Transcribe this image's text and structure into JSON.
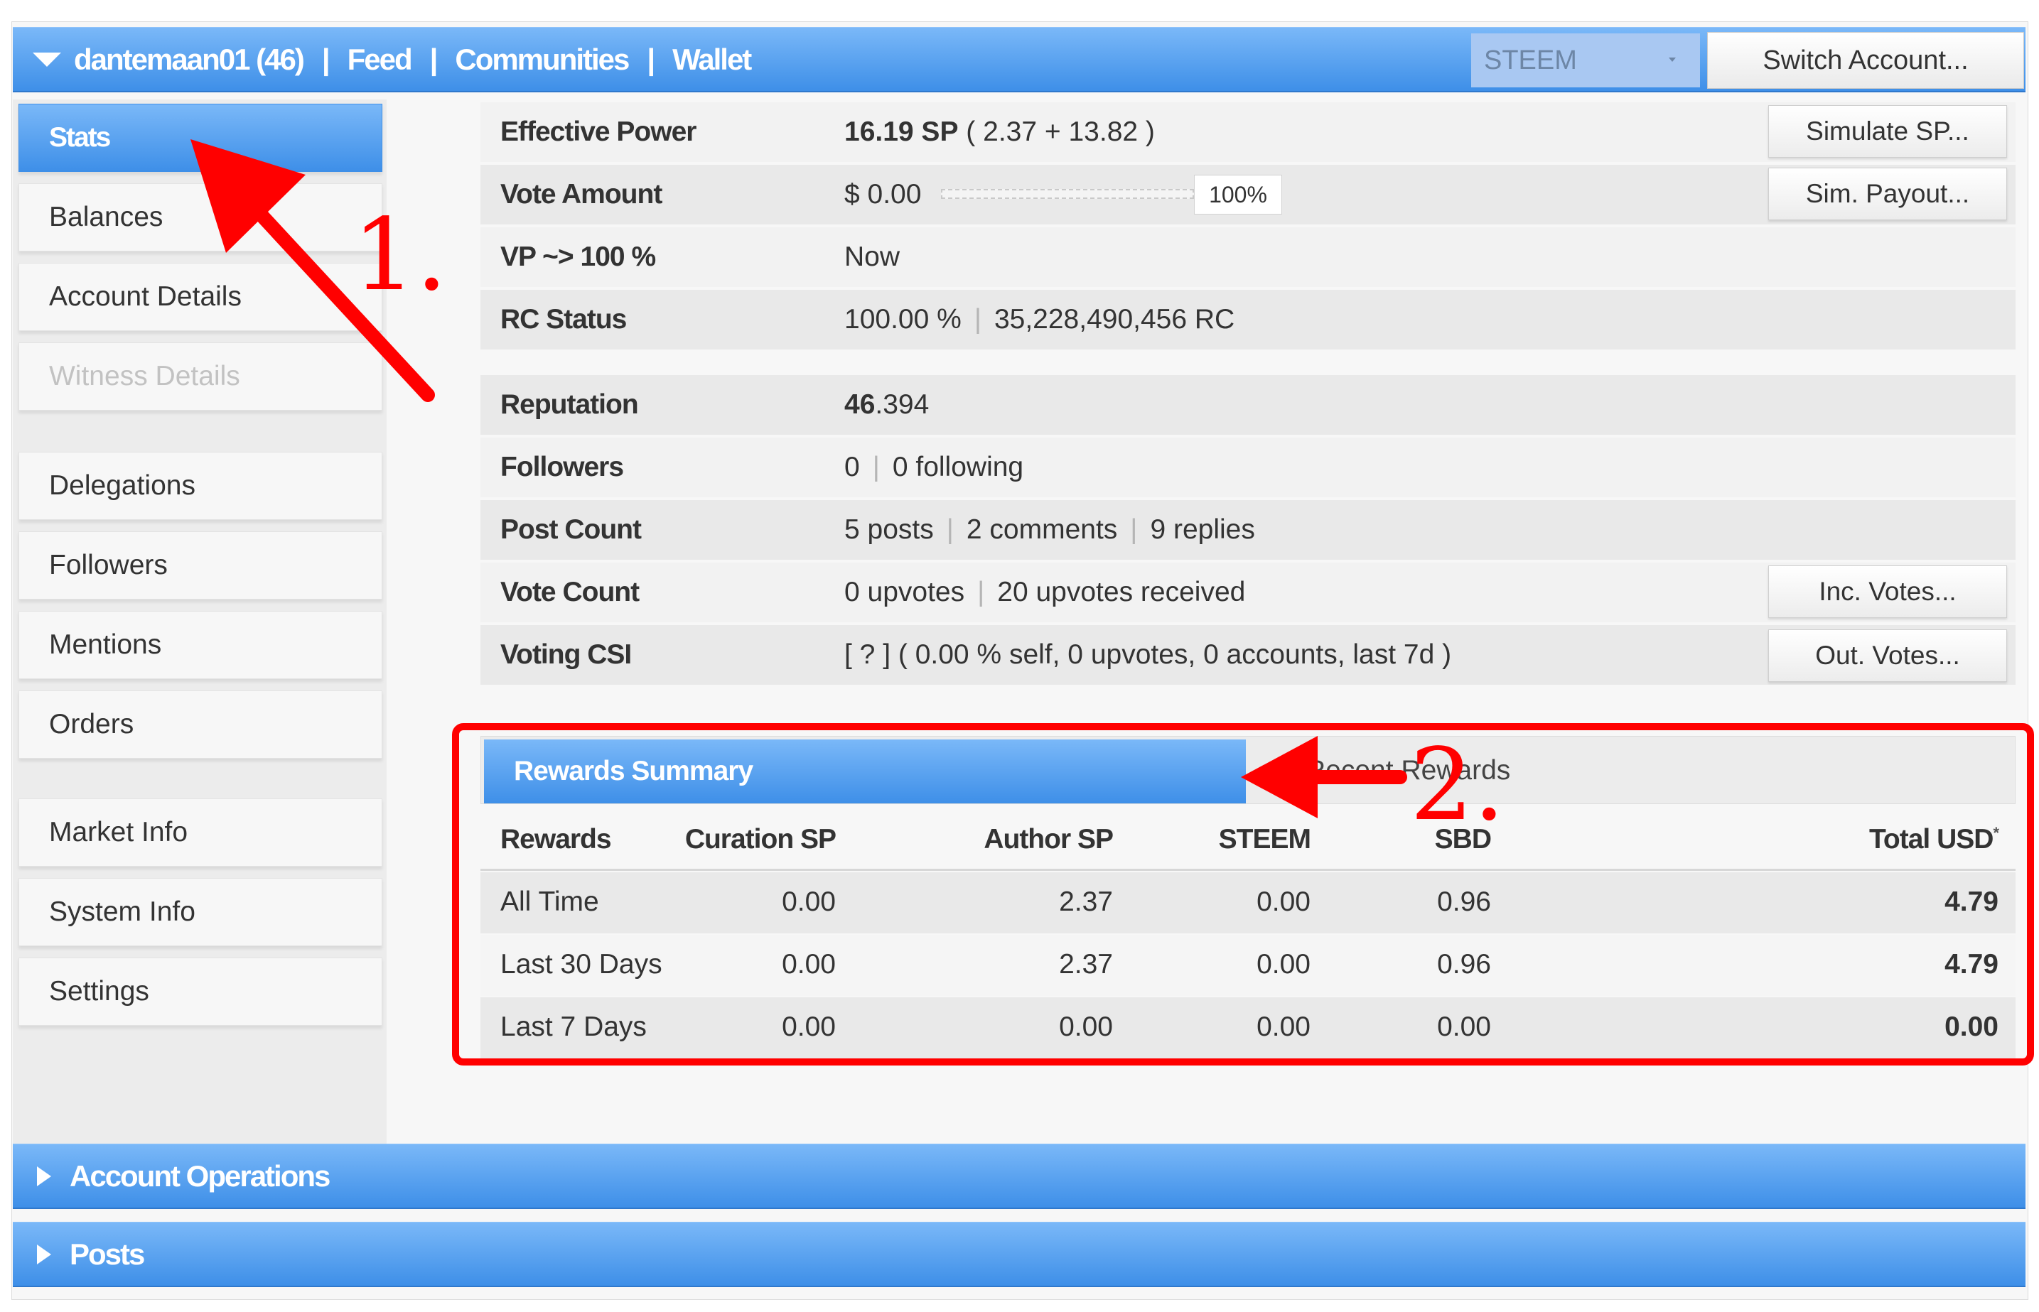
{
  "header": {
    "account": "dantemaan01 (46)",
    "nav": [
      {
        "label": "Feed"
      },
      {
        "label": "Communities"
      },
      {
        "label": "Wallet"
      }
    ],
    "separator": "|",
    "currency_select": "STEEM",
    "switch_button": "Switch Account..."
  },
  "sidebar": {
    "items": [
      {
        "label": "Stats",
        "state": "active"
      },
      {
        "label": "Balances"
      },
      {
        "label": "Account Details"
      },
      {
        "label": "Witness Details",
        "state": "disabled"
      },
      {
        "label": "Delegations"
      },
      {
        "label": "Followers"
      },
      {
        "label": "Mentions"
      },
      {
        "label": "Orders"
      },
      {
        "label": "Market Info"
      },
      {
        "label": "System Info"
      },
      {
        "label": "Settings"
      }
    ]
  },
  "stats": {
    "effective_power": {
      "label": "Effective Power",
      "main": "16.19 SP",
      "detail": " ( 2.37 + 13.82 )",
      "button": "Simulate SP..."
    },
    "vote_amount": {
      "label": "Vote Amount",
      "value": "$ 0.00",
      "percent": "100%",
      "button": "Sim. Payout..."
    },
    "vp": {
      "label": "VP ~> 100 %",
      "value": "Now"
    },
    "rc": {
      "label": "RC Status",
      "percent": "100.00 %",
      "amount": "35,228,490,456 RC"
    },
    "reputation": {
      "label": "Reputation",
      "whole": "46",
      "fraction": ".394"
    },
    "followers": {
      "label": "Followers",
      "count": "0",
      "following": "0 following"
    },
    "post_count": {
      "label": "Post Count",
      "posts": "5 posts",
      "comments": "2 comments",
      "replies": "9 replies"
    },
    "vote_count": {
      "label": "Vote Count",
      "upvotes": "0 upvotes",
      "received": "20 upvotes received",
      "button": "Inc. Votes..."
    },
    "voting_csi": {
      "label": "Voting CSI",
      "value": "[ ? ] ( 0.00 % self, 0 upvotes, 0 accounts, last 7d )",
      "button": "Out. Votes..."
    },
    "separator": "|"
  },
  "rewards": {
    "tabs": [
      {
        "label": "Rewards Summary",
        "state": "active"
      },
      {
        "label": "Recent Rewards"
      }
    ],
    "columns": [
      "Rewards",
      "Curation SP",
      "Author SP",
      "STEEM",
      "SBD",
      "Total USD"
    ],
    "total_usd_marker": "*",
    "rows": [
      {
        "period": "All Time",
        "curation_sp": "0.00",
        "author_sp": "2.37",
        "steem": "0.00",
        "sbd": "0.96",
        "total_usd": "4.79"
      },
      {
        "period": "Last 30 Days",
        "curation_sp": "0.00",
        "author_sp": "2.37",
        "steem": "0.00",
        "sbd": "0.96",
        "total_usd": "4.79"
      },
      {
        "period": "Last 7 Days",
        "curation_sp": "0.00",
        "author_sp": "0.00",
        "steem": "0.00",
        "sbd": "0.00",
        "total_usd": "0.00"
      }
    ]
  },
  "sections": [
    {
      "label": "Account Operations"
    },
    {
      "label": "Posts"
    }
  ],
  "annotations": {
    "step1": "1.",
    "step2": "2.",
    "color": "#ff0000"
  },
  "colors": {
    "accent": "#4a9af0",
    "accent_dark": "#2f78cc",
    "annotation": "#ff0000"
  }
}
